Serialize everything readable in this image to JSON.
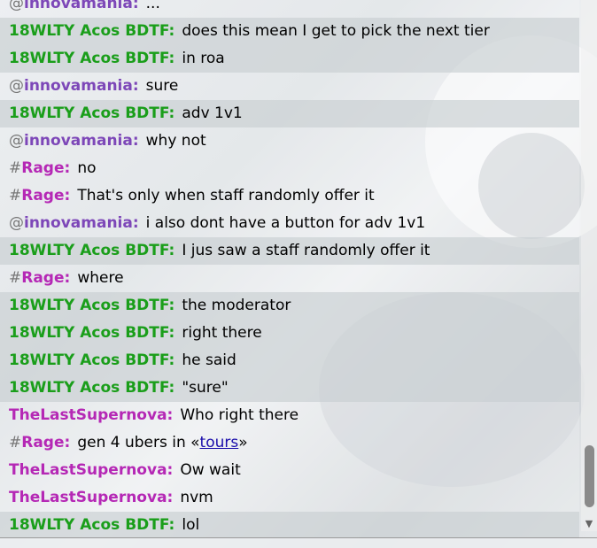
{
  "colors": {
    "green_user": "#1a9e1a",
    "purple_user": "#7d47b8",
    "magenta_user": "#b528b5",
    "rank_symbol": "#777777",
    "link": "#1a0dab"
  },
  "scrollbar": {
    "down_arrow_icon": "triangle-down",
    "position_fraction": 0.97
  },
  "messages": [
    {
      "rank": "@",
      "user": "innovamania:",
      "text": "...",
      "color": "#7d47b8",
      "shaded": false
    },
    {
      "rank": "",
      "user": "18WLTY Acos BDTF:",
      "text": "does this mean I get to pick the next tier",
      "color": "#1a9e1a",
      "shaded": true
    },
    {
      "rank": "",
      "user": "18WLTY Acos BDTF:",
      "text": "in roa",
      "color": "#1a9e1a",
      "shaded": true
    },
    {
      "rank": "@",
      "user": "innovamania:",
      "text": "sure",
      "color": "#7d47b8",
      "shaded": false
    },
    {
      "rank": "",
      "user": "18WLTY Acos BDTF:",
      "text": "adv 1v1",
      "color": "#1a9e1a",
      "shaded": true
    },
    {
      "rank": "@",
      "user": "innovamania:",
      "text": "why not",
      "color": "#7d47b8",
      "shaded": false
    },
    {
      "rank": "#",
      "user": "Rage:",
      "text": "no",
      "color": "#b528b5",
      "shaded": false
    },
    {
      "rank": "#",
      "user": "Rage:",
      "text": "That's only when staff randomly offer it",
      "color": "#b528b5",
      "shaded": false
    },
    {
      "rank": "@",
      "user": "innovamania:",
      "text": "i also dont have a button for adv 1v1",
      "color": "#7d47b8",
      "shaded": false
    },
    {
      "rank": "",
      "user": "18WLTY Acos BDTF:",
      "text": "I jus saw a staff randomly offer it",
      "color": "#1a9e1a",
      "shaded": true
    },
    {
      "rank": "#",
      "user": "Rage:",
      "text": "where",
      "color": "#b528b5",
      "shaded": false
    },
    {
      "rank": "",
      "user": "18WLTY Acos BDTF:",
      "text": "the moderator",
      "color": "#1a9e1a",
      "shaded": true
    },
    {
      "rank": "",
      "user": "18WLTY Acos BDTF:",
      "text": "right there",
      "color": "#1a9e1a",
      "shaded": true
    },
    {
      "rank": "",
      "user": "18WLTY Acos BDTF:",
      "text": "he said",
      "color": "#1a9e1a",
      "shaded": true
    },
    {
      "rank": "",
      "user": "18WLTY Acos BDTF:",
      "text": "\"sure\"",
      "color": "#1a9e1a",
      "shaded": true
    },
    {
      "rank": "",
      "user": "TheLastSupernova:",
      "text": "Who right there",
      "color": "#b528b5",
      "shaded": false
    },
    {
      "rank": "#",
      "user": "Rage:",
      "text_before": "gen 4 ubers in «",
      "link": "tours",
      "text_after": "»",
      "color": "#b528b5",
      "shaded": false
    },
    {
      "rank": "",
      "user": "TheLastSupernova:",
      "text": "Ow wait",
      "color": "#b528b5",
      "shaded": false
    },
    {
      "rank": "",
      "user": "TheLastSupernova:",
      "text": "nvm",
      "color": "#b528b5",
      "shaded": false
    },
    {
      "rank": "",
      "user": "18WLTY Acos BDTF:",
      "text": "lol",
      "color": "#1a9e1a",
      "shaded": true
    }
  ]
}
